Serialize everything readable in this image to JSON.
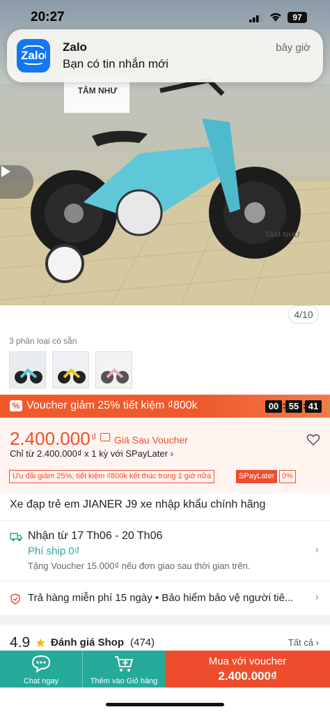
{
  "status_bar": {
    "time": "20:27",
    "battery": "97"
  },
  "notification": {
    "app_icon_text": "Zalo",
    "app_name": "Zalo",
    "message": "Bạn có tin nhắn mới",
    "time": "bây giờ"
  },
  "gallery": {
    "counter": "4/10",
    "watermark": "TÂM NHƯ"
  },
  "variants": {
    "label": "3 phân loại có sẵn",
    "count": 3
  },
  "voucher_banner": {
    "icon": "%",
    "text": "Voucher giảm 25% tiết kiệm ₫800k",
    "timer": [
      "00",
      "55",
      "41"
    ]
  },
  "price": {
    "value": "2.400.000",
    "currency": "₫",
    "after_voucher": "Giá Sau Voucher",
    "spaylater": "Chỉ từ 2.400.000₫ x 1 kỳ với SPayLater ›",
    "promo": "Ưu đãi giảm 25%, tiết kiệm ₫800k kết thúc trong 1 giờ nữa",
    "spl_badge": "SPayLater",
    "spl_pct": "0%"
  },
  "product": {
    "title": "Xe đạp trẻ em JIANER J9 xe nhập khẩu chính hãng"
  },
  "shipping": {
    "date": "Nhận từ 17 Th06 - 20 Th06",
    "fee": "Phí ship 0₫",
    "note": "Tặng Voucher 15.000₫ nếu đơn giao sau thời gian trên."
  },
  "return_policy": {
    "text": "Trả hàng miễn phí 15 ngày  •  Bảo hiểm bảo vệ người tiê..."
  },
  "rating": {
    "score": "4.9",
    "star": "★",
    "label": "Đánh giá Shop",
    "count": "(474)",
    "see_all": "Tất cả ›"
  },
  "bottom_bar": {
    "chat_label": "Chat ngay",
    "cart_label": "Thêm vào Giỏ hàng",
    "buy_line1": "Mua với voucher",
    "buy_line2": "2.400.000₫"
  },
  "colors": {
    "brand": "#ee4d2d",
    "teal": "#26aa99"
  }
}
